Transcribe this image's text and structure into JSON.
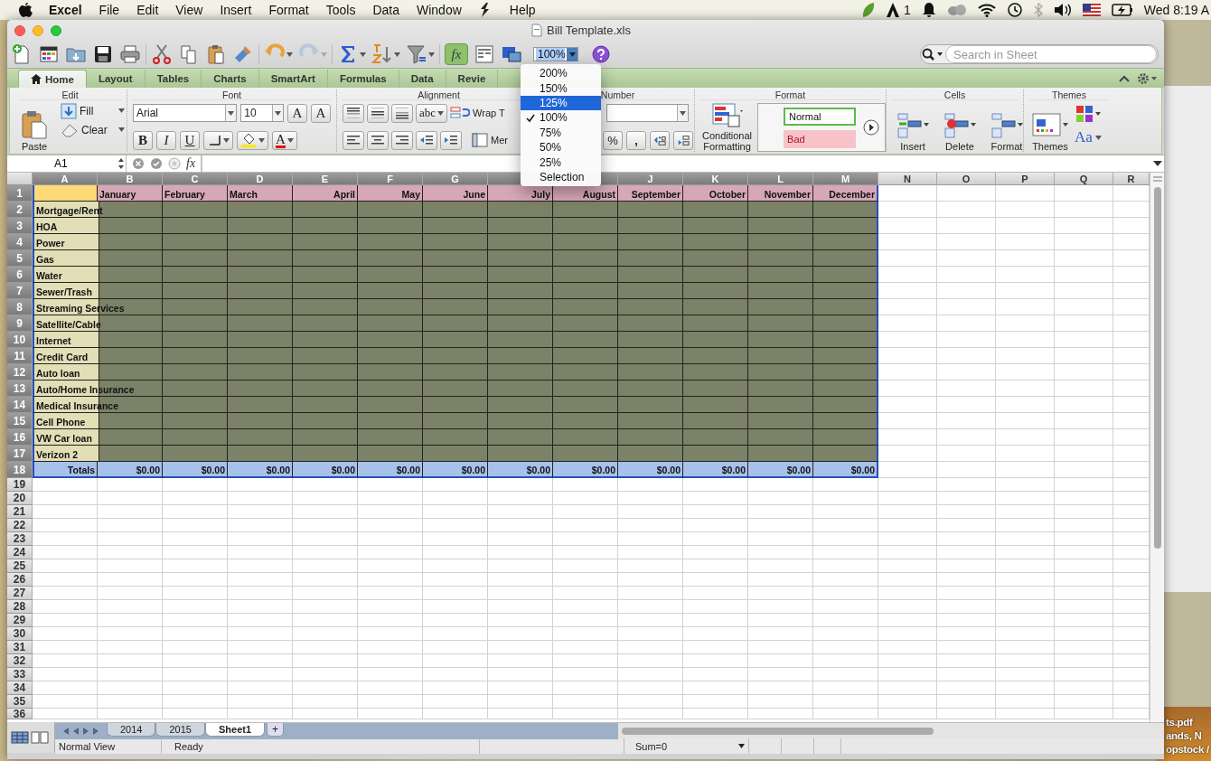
{
  "menubar": {
    "app": "Excel",
    "menus": [
      {
        "kind": "text",
        "label": "File"
      },
      {
        "kind": "text",
        "label": "Edit"
      },
      {
        "kind": "text",
        "label": "View"
      },
      {
        "kind": "text",
        "label": "Insert"
      },
      {
        "kind": "text",
        "label": "Format"
      },
      {
        "kind": "text",
        "label": "Tools"
      },
      {
        "kind": "text",
        "label": "Data"
      },
      {
        "kind": "text",
        "label": "Window"
      },
      {
        "kind": "icon"
      },
      {
        "kind": "text",
        "label": "Help"
      }
    ],
    "badge": "1",
    "clock": "Wed 8:19 A"
  },
  "window": {
    "title": "Bill Template.xls"
  },
  "toolbar": {
    "formula_builder": {
      "label": "fx",
      "on": true
    },
    "zoom": "100%",
    "search": {
      "placeholder": "Search in Sheet"
    }
  },
  "ribbon": {
    "tabs": [
      {
        "label": "Home",
        "selected": true
      },
      {
        "label": "Layout",
        "selected": false
      },
      {
        "label": "Tables",
        "selected": false
      },
      {
        "label": "Charts",
        "selected": false
      },
      {
        "label": "SmartArt",
        "selected": false
      },
      {
        "label": "Formulas",
        "selected": false
      },
      {
        "label": "Data",
        "selected": false
      },
      {
        "label": "Revie",
        "selected": false
      }
    ],
    "edit": {
      "title": "Edit",
      "paste": "Paste",
      "fill": "Fill",
      "clear": "Clear"
    },
    "font": {
      "title": "Font",
      "name": "Arial",
      "size": "10",
      "grow": "A",
      "shrink": "A",
      "bold": "B",
      "italic": "I",
      "underline": "U",
      "font_color": "A"
    },
    "alignment": {
      "title": "Alignment",
      "orientation": "abc",
      "wrap": "Wrap T",
      "merge": "Mer"
    },
    "number": {
      "title": "Number",
      "percent": "%",
      "comma": ","
    },
    "format": {
      "title": "Format",
      "conditional": "Conditional Formatting",
      "styles": [
        {
          "label": "Normal",
          "kind": "normal"
        },
        {
          "label": "Bad",
          "kind": "bad"
        }
      ]
    },
    "cells": {
      "title": "Cells",
      "buttons": [
        "Insert",
        "Delete",
        "Format"
      ]
    },
    "themes": {
      "title": "Themes",
      "button": "Themes",
      "fonts": "Aa"
    }
  },
  "formula_bar": {
    "name_box": "A1",
    "fx": "fx"
  },
  "sheet": {
    "columns": [
      {
        "label": "A",
        "selected": true
      },
      {
        "label": "B",
        "selected": true
      },
      {
        "label": "C",
        "selected": true
      },
      {
        "label": "D",
        "selected": true
      },
      {
        "label": "E",
        "selected": true
      },
      {
        "label": "F",
        "selected": true
      },
      {
        "label": "G",
        "selected": true
      },
      {
        "selected": true
      },
      {
        "selected": true
      },
      {
        "label": "J",
        "selected": true
      },
      {
        "label": "K",
        "selected": true
      },
      {
        "label": "L",
        "selected": true
      },
      {
        "label": "M",
        "selected": true
      },
      {
        "label": "N",
        "selected": false
      },
      {
        "label": "O",
        "selected": false
      },
      {
        "label": "P",
        "selected": false
      },
      {
        "label": "Q",
        "selected": false
      },
      {
        "label": "R",
        "selected": false
      }
    ],
    "months": [
      {
        "label": "January",
        "right_aligned": false
      },
      {
        "label": "February",
        "right_aligned": false
      },
      {
        "label": "March",
        "right_aligned": false
      },
      {
        "label": "April",
        "right_aligned": true
      },
      {
        "label": "May",
        "right_aligned": true
      },
      {
        "label": "June",
        "right_aligned": true
      },
      {
        "label": "July",
        "right_aligned": true
      },
      {
        "label": "August",
        "right_aligned": true
      },
      {
        "label": "September",
        "right_aligned": true
      },
      {
        "label": "October",
        "right_aligned": true
      },
      {
        "label": "November",
        "right_aligned": true
      },
      {
        "label": "December",
        "right_aligned": true
      }
    ],
    "items": [
      "Mortgage/Rent",
      "HOA",
      "Power",
      "Gas",
      "Water",
      "Sewer/Trash",
      "Streaming Services",
      "Satellite/Cable",
      "Internet",
      "Credit Card",
      "Auto loan",
      "Auto/Home Insurance",
      "Medical Insurance",
      "Cell Phone",
      "VW Car loan",
      "Verizon 2"
    ],
    "totals": {
      "label": "Totals",
      "values": [
        "$0.00",
        "$0.00",
        "$0.00",
        "$0.00",
        "$0.00",
        "$0.00",
        "$0.00",
        "$0.00",
        "$0.00",
        "$0.00",
        "$0.00",
        "$0.00"
      ]
    },
    "rows": [
      {
        "label": "1",
        "selected": true
      },
      {
        "label": "2",
        "selected": true
      },
      {
        "label": "3",
        "selected": true
      },
      {
        "label": "4",
        "selected": true
      },
      {
        "label": "5",
        "selected": true
      },
      {
        "label": "6",
        "selected": true
      },
      {
        "label": "7",
        "selected": true
      },
      {
        "label": "8",
        "selected": true
      },
      {
        "label": "9",
        "selected": true
      },
      {
        "label": "10",
        "selected": true
      },
      {
        "label": "11",
        "selected": true
      },
      {
        "label": "12",
        "selected": true
      },
      {
        "label": "13",
        "selected": true
      },
      {
        "label": "14",
        "selected": true
      },
      {
        "label": "15",
        "selected": true
      },
      {
        "label": "16",
        "selected": true
      },
      {
        "label": "17",
        "selected": true
      },
      {
        "label": "18",
        "selected": true
      },
      {
        "label": "19",
        "selected": false
      },
      {
        "label": "20",
        "selected": false
      },
      {
        "label": "21",
        "selected": false
      },
      {
        "label": "22",
        "selected": false
      },
      {
        "label": "23",
        "selected": false
      },
      {
        "label": "24",
        "selected": false
      },
      {
        "label": "25",
        "selected": false
      },
      {
        "label": "26",
        "selected": false
      },
      {
        "label": "27",
        "selected": false
      },
      {
        "label": "28",
        "selected": false
      },
      {
        "label": "29",
        "selected": false
      },
      {
        "label": "30",
        "selected": false
      },
      {
        "label": "31",
        "selected": false
      },
      {
        "label": "32",
        "selected": false
      },
      {
        "label": "33",
        "selected": false
      },
      {
        "label": "34",
        "selected": false
      },
      {
        "label": "35",
        "selected": false
      },
      {
        "label": "36",
        "selected": false
      }
    ]
  },
  "zoom_menu": {
    "items": [
      {
        "label": "200%",
        "selected": false,
        "checked": false
      },
      {
        "label": "150%",
        "selected": false,
        "checked": false
      },
      {
        "label": "125%",
        "selected": true,
        "checked": false
      },
      {
        "label": "100%",
        "selected": false,
        "checked": true
      },
      {
        "label": "75%",
        "selected": false,
        "checked": false
      },
      {
        "label": "50%",
        "selected": false,
        "checked": false
      },
      {
        "label": "25%",
        "selected": false,
        "checked": false
      },
      {
        "label": "Selection",
        "selected": false,
        "checked": false
      }
    ]
  },
  "sheet_tabs": {
    "tabs": [
      {
        "label": "2014",
        "selected": false
      },
      {
        "label": "2015",
        "selected": false
      },
      {
        "label": "Sheet1",
        "selected": true
      }
    ],
    "add": "+"
  },
  "status_bar": {
    "view": "Normal View",
    "state": "Ready",
    "sum": "Sum=0"
  },
  "desktop": {
    "labels": [
      "ts.pdf",
      "ands, N",
      "opstock /"
    ]
  }
}
